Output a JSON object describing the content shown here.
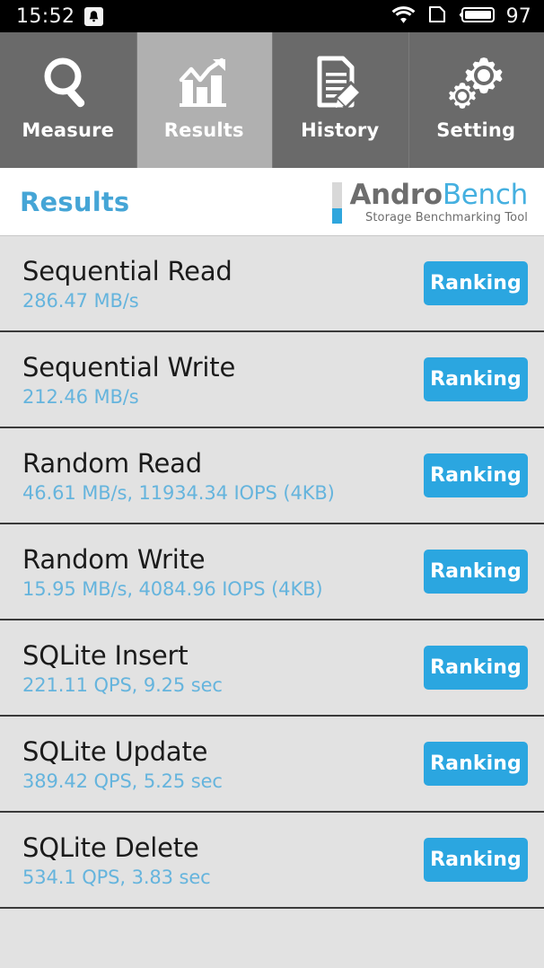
{
  "statusbar": {
    "time": "15:52",
    "notification_icon": "bell-icon",
    "wifi_icon": "wifi-icon",
    "sim_icon": "sim-card-icon",
    "battery_icon": "battery-icon",
    "battery_percent": "97"
  },
  "tabs": [
    {
      "label": "Measure",
      "icon": "magnifier-icon",
      "selected": false
    },
    {
      "label": "Results",
      "icon": "bar-chart-icon",
      "selected": true
    },
    {
      "label": "History",
      "icon": "document-pencil-icon",
      "selected": false
    },
    {
      "label": "Setting",
      "icon": "gears-icon",
      "selected": false
    }
  ],
  "header": {
    "title": "Results",
    "logo_andro": "Andro",
    "logo_bench": "Bench",
    "logo_subtitle": "Storage Benchmarking Tool"
  },
  "results": [
    {
      "name": "Sequential Read",
      "value": "286.47 MB/s",
      "button": "Ranking"
    },
    {
      "name": "Sequential Write",
      "value": "212.46 MB/s",
      "button": "Ranking"
    },
    {
      "name": "Random Read",
      "value": "46.61 MB/s, 11934.34 IOPS (4KB)",
      "button": "Ranking"
    },
    {
      "name": "Random Write",
      "value": "15.95 MB/s, 4084.96 IOPS (4KB)",
      "button": "Ranking"
    },
    {
      "name": "SQLite Insert",
      "value": "221.11 QPS, 9.25 sec",
      "button": "Ranking"
    },
    {
      "name": "SQLite Update",
      "value": "389.42 QPS, 5.25 sec",
      "button": "Ranking"
    },
    {
      "name": "SQLite Delete",
      "value": "534.1 QPS, 3.83 sec",
      "button": "Ranking"
    }
  ],
  "colors": {
    "accent_blue": "#2ba6e0",
    "title_blue": "#45a5d6",
    "value_blue": "#65b4dd",
    "tab_bg": "#6a6a6a",
    "tab_selected_bg": "#b0b0b0",
    "list_bg": "#e2e2e2",
    "statusbar_bg": "#000000"
  }
}
